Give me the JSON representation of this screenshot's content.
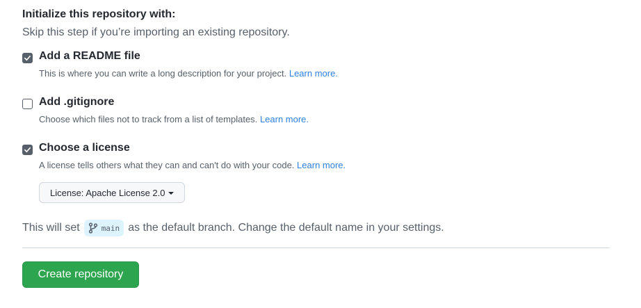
{
  "section": {
    "title": "Initialize this repository with:",
    "subtitle": "Skip this step if you’re importing an existing repository."
  },
  "options": [
    {
      "label": "Add a README file",
      "checked": true,
      "description": "This is where you can write a long description for your project.",
      "link": "Learn more."
    },
    {
      "label": "Add .gitignore",
      "checked": false,
      "description": "Choose which files not to track from a list of templates.",
      "link": "Learn more."
    },
    {
      "label": "Choose a license",
      "checked": true,
      "description": "A license tells others what they can and can't do with your code.",
      "link": "Learn more."
    }
  ],
  "license": {
    "button_label": "License: Apache License 2.0"
  },
  "branch": {
    "prefix": "This will set",
    "name": "main",
    "suffix": "as the default branch. Change the default name in your settings."
  },
  "actions": {
    "create_label": "Create repository"
  },
  "colors": {
    "create_button": "#2da44e",
    "checkbox_checked": "#57606a",
    "link": "#0969da",
    "branch_chip": "#ddf4ff"
  },
  "icons": {
    "checkbox_checked": "check-icon",
    "branch": "git-branch-icon",
    "dropdown": "caret-down-icon"
  }
}
